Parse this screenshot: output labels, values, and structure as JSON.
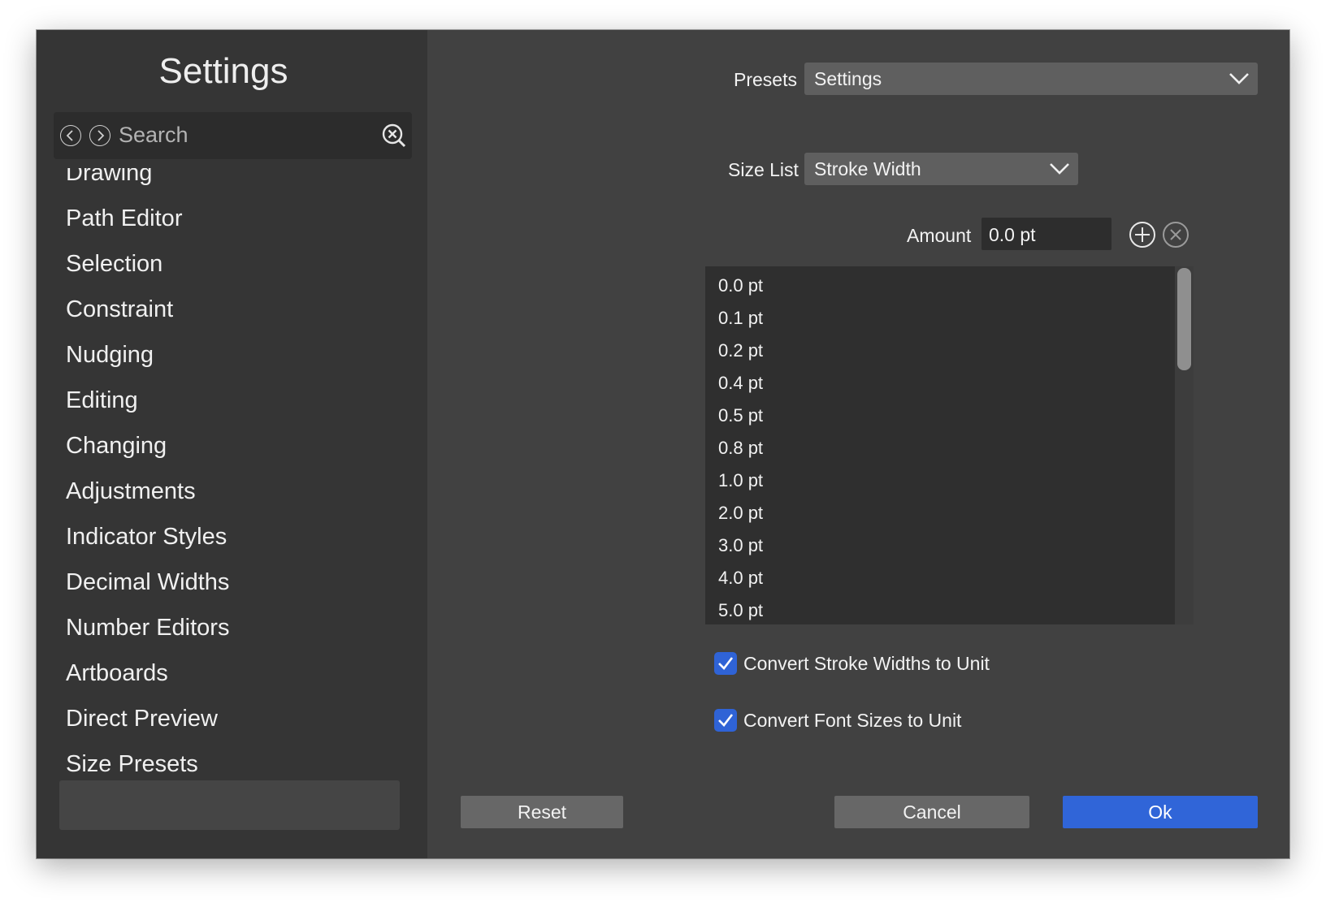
{
  "sidebar": {
    "title": "Settings",
    "search_placeholder": "Search",
    "items": [
      "Drawing",
      "Path Editor",
      "Selection",
      "Constraint",
      "Nudging",
      "Editing",
      "Changing",
      "Adjustments",
      "Indicator Styles",
      "Decimal Widths",
      "Number Editors",
      "Artboards",
      "Direct Preview",
      "Size Presets"
    ],
    "selected": "Size Presets"
  },
  "main": {
    "presets_label": "Presets",
    "presets_value": "Settings",
    "size_list_label": "Size List",
    "size_list_value": "Stroke Width",
    "amount_label": "Amount",
    "amount_value": "0.0 pt",
    "list_items": [
      "0.0 pt",
      "0.1 pt",
      "0.2 pt",
      "0.4 pt",
      "0.5 pt",
      "0.8 pt",
      "1.0 pt",
      "2.0 pt",
      "3.0 pt",
      "4.0 pt",
      "5.0 pt"
    ],
    "checkboxes": [
      {
        "label": "Convert Stroke Widths to Unit",
        "checked": true
      },
      {
        "label": "Convert Font Sizes to Unit",
        "checked": true
      }
    ]
  },
  "buttons": {
    "reset": "Reset",
    "cancel": "Cancel",
    "ok": "Ok"
  },
  "colors": {
    "accent": "#3065d8",
    "sidebar_bg": "#353535",
    "panel_bg": "#414141"
  }
}
